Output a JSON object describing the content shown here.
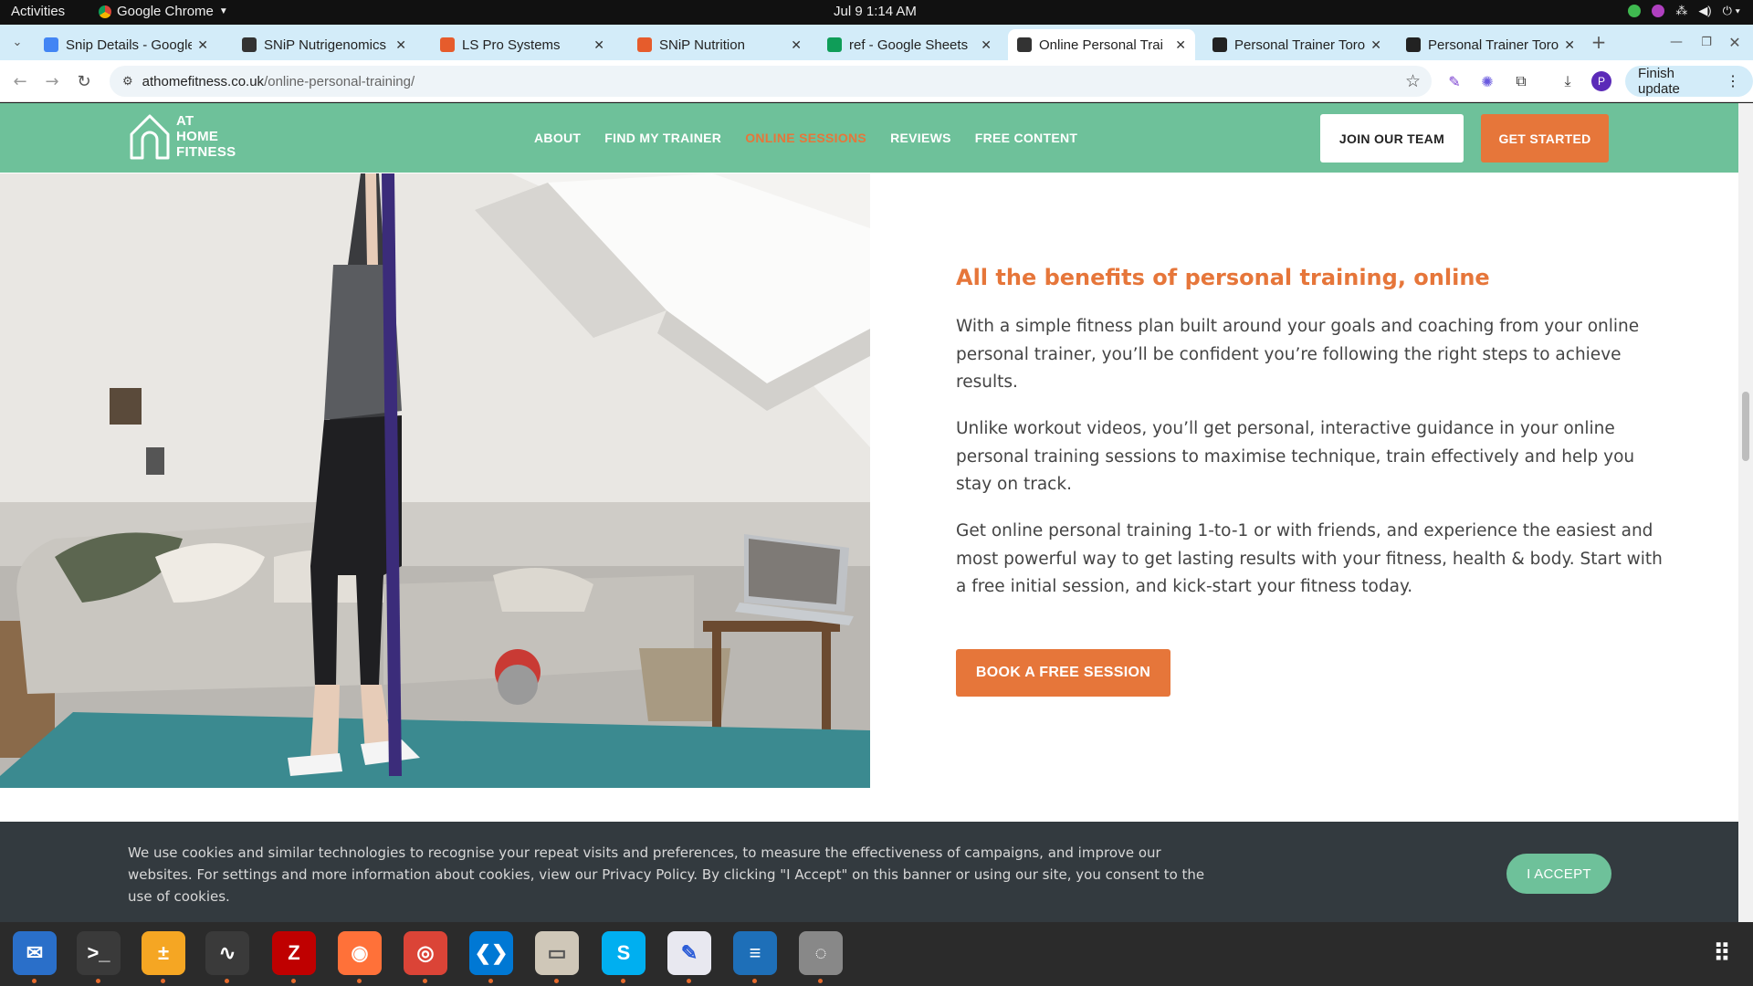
{
  "topbar": {
    "activities": "Activities",
    "app_name": "Google Chrome",
    "clock": "Jul 9  1:14 AM"
  },
  "tabs": [
    {
      "title": "Snip Details - Google",
      "favicon": "docs-icon",
      "color": "#4285f4"
    },
    {
      "title": "SNiP Nutrigenomics",
      "favicon": "snip-icon",
      "color": "#333333"
    },
    {
      "title": "LS Pro Systems",
      "favicon": "ls-icon",
      "color": "#e65c2c"
    },
    {
      "title": "SNiP Nutrition",
      "favicon": "snip-nutrition-icon",
      "color": "#e65c2c"
    },
    {
      "title": "ref - Google Sheets",
      "favicon": "sheets-icon",
      "color": "#0f9d58"
    },
    {
      "title": "Online Personal Trai",
      "favicon": "athome-icon",
      "color": "#333333"
    },
    {
      "title": "Personal Trainer Toro",
      "favicon": "fs-icon",
      "color": "#222222"
    },
    {
      "title": "Personal Trainer Toro",
      "favicon": "fs-icon",
      "color": "#222222"
    }
  ],
  "toolbar": {
    "url_domain": "athomefitness.co.uk",
    "url_path": "/online-personal-training/",
    "profile_initial": "P",
    "finish_update": "Finish update"
  },
  "site": {
    "logo_lines": [
      "AT",
      "HOME",
      "FITNESS"
    ],
    "nav": [
      {
        "label": "ABOUT",
        "active": false
      },
      {
        "label": "FIND MY TRAINER",
        "active": false
      },
      {
        "label": "ONLINE SESSIONS",
        "active": true
      },
      {
        "label": "REVIEWS",
        "active": false
      },
      {
        "label": "FREE CONTENT",
        "active": false
      }
    ],
    "join_label": "JOIN OUR TEAM",
    "start_label": "GET STARTED",
    "colors": {
      "brand_green": "#6ec19a",
      "accent_orange": "#e6763a"
    }
  },
  "content": {
    "heading": "All the benefits of personal training, online",
    "paragraphs": [
      "With a simple fitness plan built around your goals and coaching from your online personal trainer, you’ll be confident you’re following the right steps to achieve results.",
      "Unlike workout videos, you’ll get personal, interactive guidance in your online personal training sessions to maximise technique, train effectively and help you stay on track.",
      "Get online personal training 1-to-1 or with friends, and experience the easiest and most powerful way to get lasting results with your fitness, health & body. Start with a free initial session, and kick-start your fitness today."
    ],
    "book_label": "BOOK A FREE SESSION"
  },
  "cookie": {
    "text": "We use cookies and similar technologies to recognise your repeat visits and preferences, to measure the effectiveness of campaigns, and improve our websites. For settings and more information about cookies, view our Privacy Policy. By clicking \"I Accept\" on this banner or using our site, you consent to the use of cookies.",
    "accept_label": "I ACCEPT"
  },
  "dock": [
    {
      "name": "thunderbird-icon",
      "color": "#2a6fc9",
      "glyph": "✉"
    },
    {
      "name": "terminal-icon",
      "color": "#3a3a3a",
      "glyph": ">_"
    },
    {
      "name": "calculator-icon",
      "color": "#f5a623",
      "glyph": "±"
    },
    {
      "name": "system-monitor-icon",
      "color": "#3a3a3a",
      "glyph": "∿"
    },
    {
      "name": "filezilla-icon",
      "color": "#bf0000",
      "glyph": "Z"
    },
    {
      "name": "firefox-icon",
      "color": "#ff7139",
      "glyph": "◉"
    },
    {
      "name": "chrome-icon",
      "color": "#db4437",
      "glyph": "◎"
    },
    {
      "name": "vscode-icon",
      "color": "#0078d4",
      "glyph": "❮❯"
    },
    {
      "name": "files-icon",
      "color": "#cfc7b8",
      "glyph": "▭"
    },
    {
      "name": "skype-icon",
      "color": "#00aff0",
      "glyph": "S"
    },
    {
      "name": "text-editor-icon",
      "color": "#e8e8f0",
      "glyph": "✎"
    },
    {
      "name": "writer-icon",
      "color": "#1e6fb8",
      "glyph": "≡"
    },
    {
      "name": "disk-icon",
      "color": "#888888",
      "glyph": "◌"
    }
  ]
}
